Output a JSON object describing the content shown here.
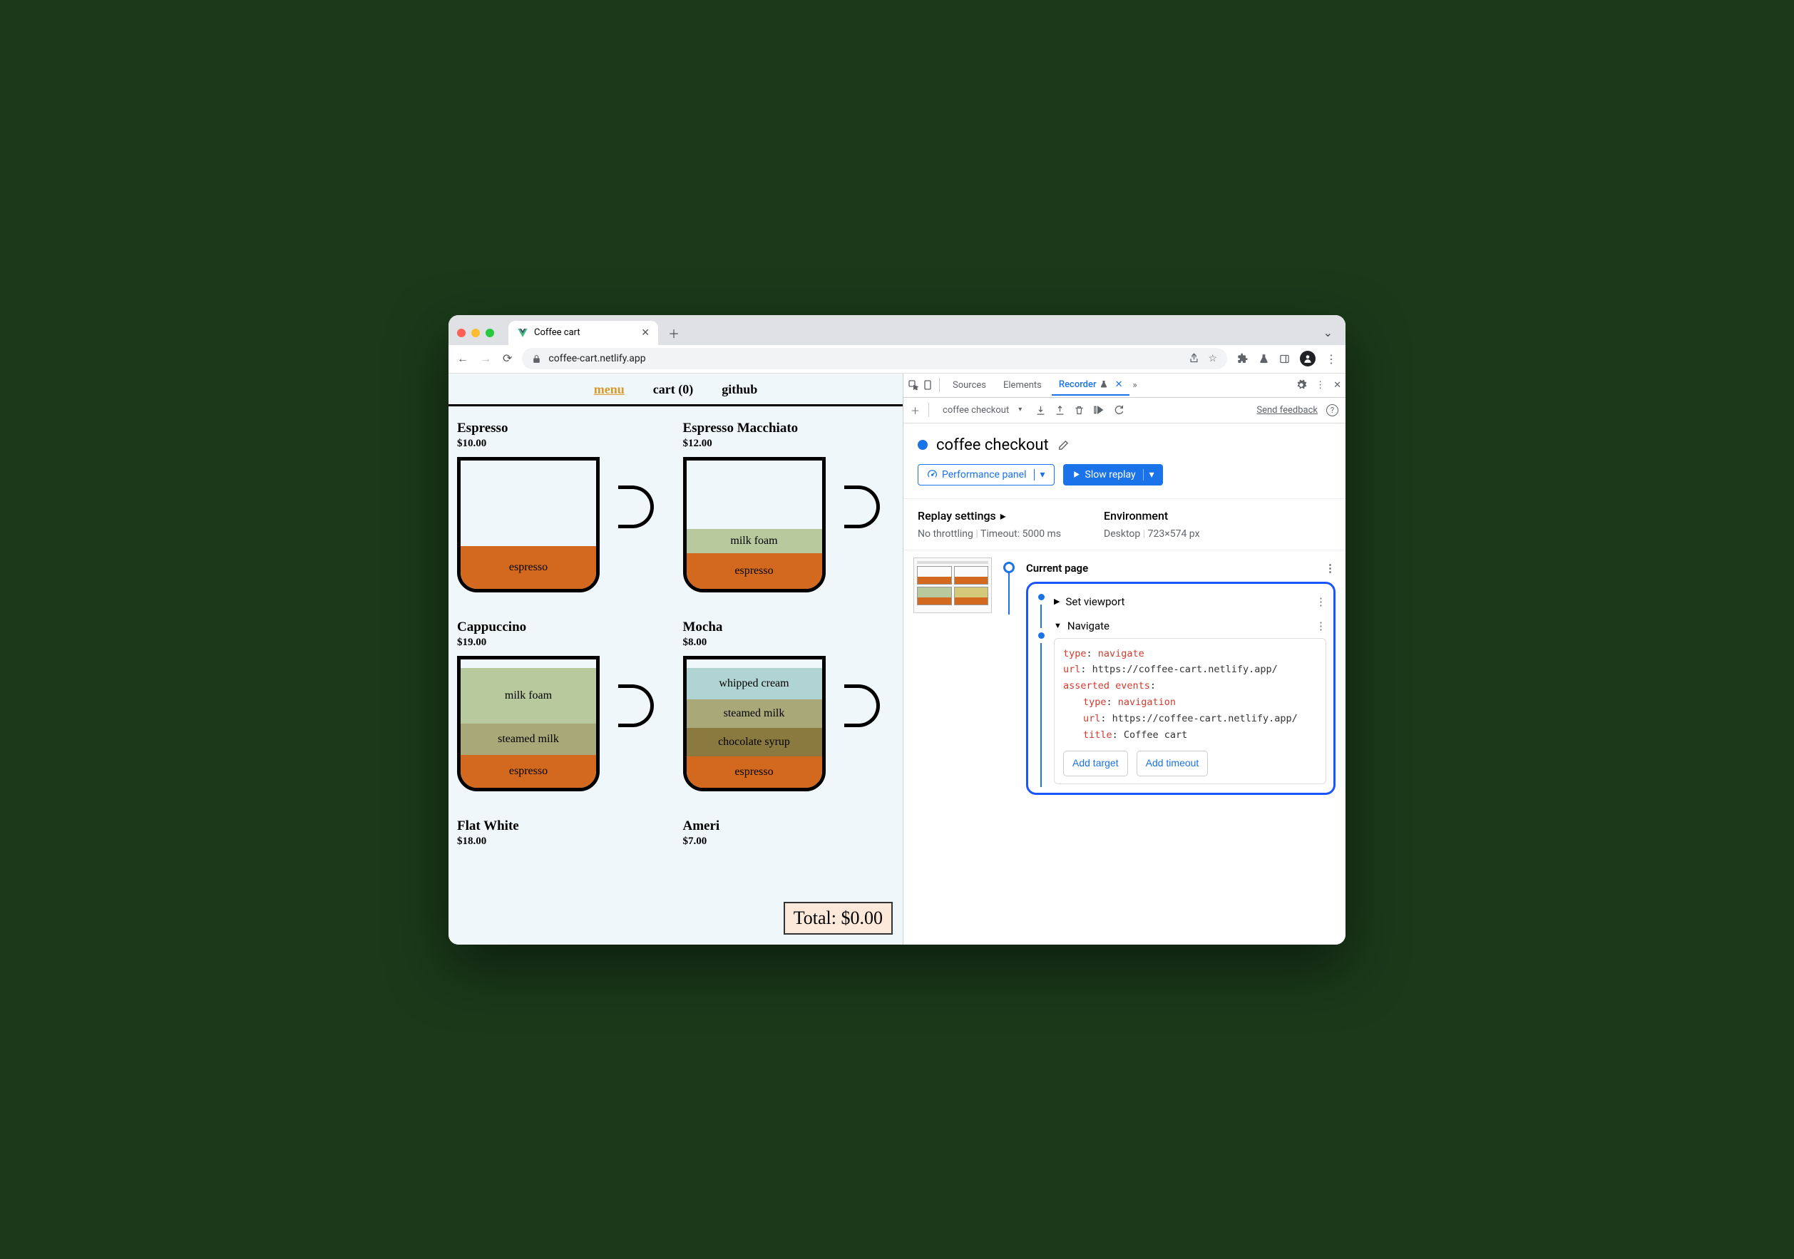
{
  "browser": {
    "tab_title": "Coffee cart",
    "url": "coffee-cart.netlify.app"
  },
  "page": {
    "nav": {
      "menu": "menu",
      "cart": "cart (0)",
      "github": "github"
    },
    "products": [
      {
        "name": "Espresso",
        "price": "$10.00"
      },
      {
        "name": "Espresso Macchiato",
        "price": "$12.00"
      },
      {
        "name": "Cappuccino",
        "price": "$19.00"
      },
      {
        "name": "Mocha",
        "price": "$8.00"
      },
      {
        "name": "Flat White",
        "price": "$18.00"
      },
      {
        "name": "Ameri",
        "price": "$7.00"
      }
    ],
    "layers": {
      "espresso": "espresso",
      "milk_foam": "milk foam",
      "steamed_milk": "steamed milk",
      "chocolate_syrup": "chocolate syrup",
      "whipped_cream": "whipped cream"
    },
    "total": "Total: $0.00"
  },
  "devtools": {
    "tabs": {
      "sources": "Sources",
      "elements": "Elements",
      "recorder": "Recorder"
    },
    "toolbar": {
      "recording_name": "coffee checkout",
      "feedback": "Send feedback"
    },
    "recording": {
      "title": "coffee checkout",
      "perf_btn": "Performance panel",
      "replay_btn": "Slow replay"
    },
    "settings": {
      "replay_h": "Replay settings",
      "throttling": "No throttling",
      "timeout": "Timeout: 5000 ms",
      "env_h": "Environment",
      "device": "Desktop",
      "viewport": "723×574 px"
    },
    "steps": {
      "current_page": "Current page",
      "set_viewport": "Set viewport",
      "navigate": "Navigate",
      "detail": {
        "type_k": "type",
        "type_v": "navigate",
        "url_k": "url",
        "url_v": "https://coffee-cart.netlify.app/",
        "ae_k": "asserted events",
        "ae_type_k": "type",
        "ae_type_v": "navigation",
        "ae_url_k": "url",
        "ae_url_v": "https://coffee-cart.netlify.app/",
        "ae_title_k": "title",
        "ae_title_v": "Coffee cart"
      },
      "add_target": "Add target",
      "add_timeout": "Add timeout"
    }
  }
}
